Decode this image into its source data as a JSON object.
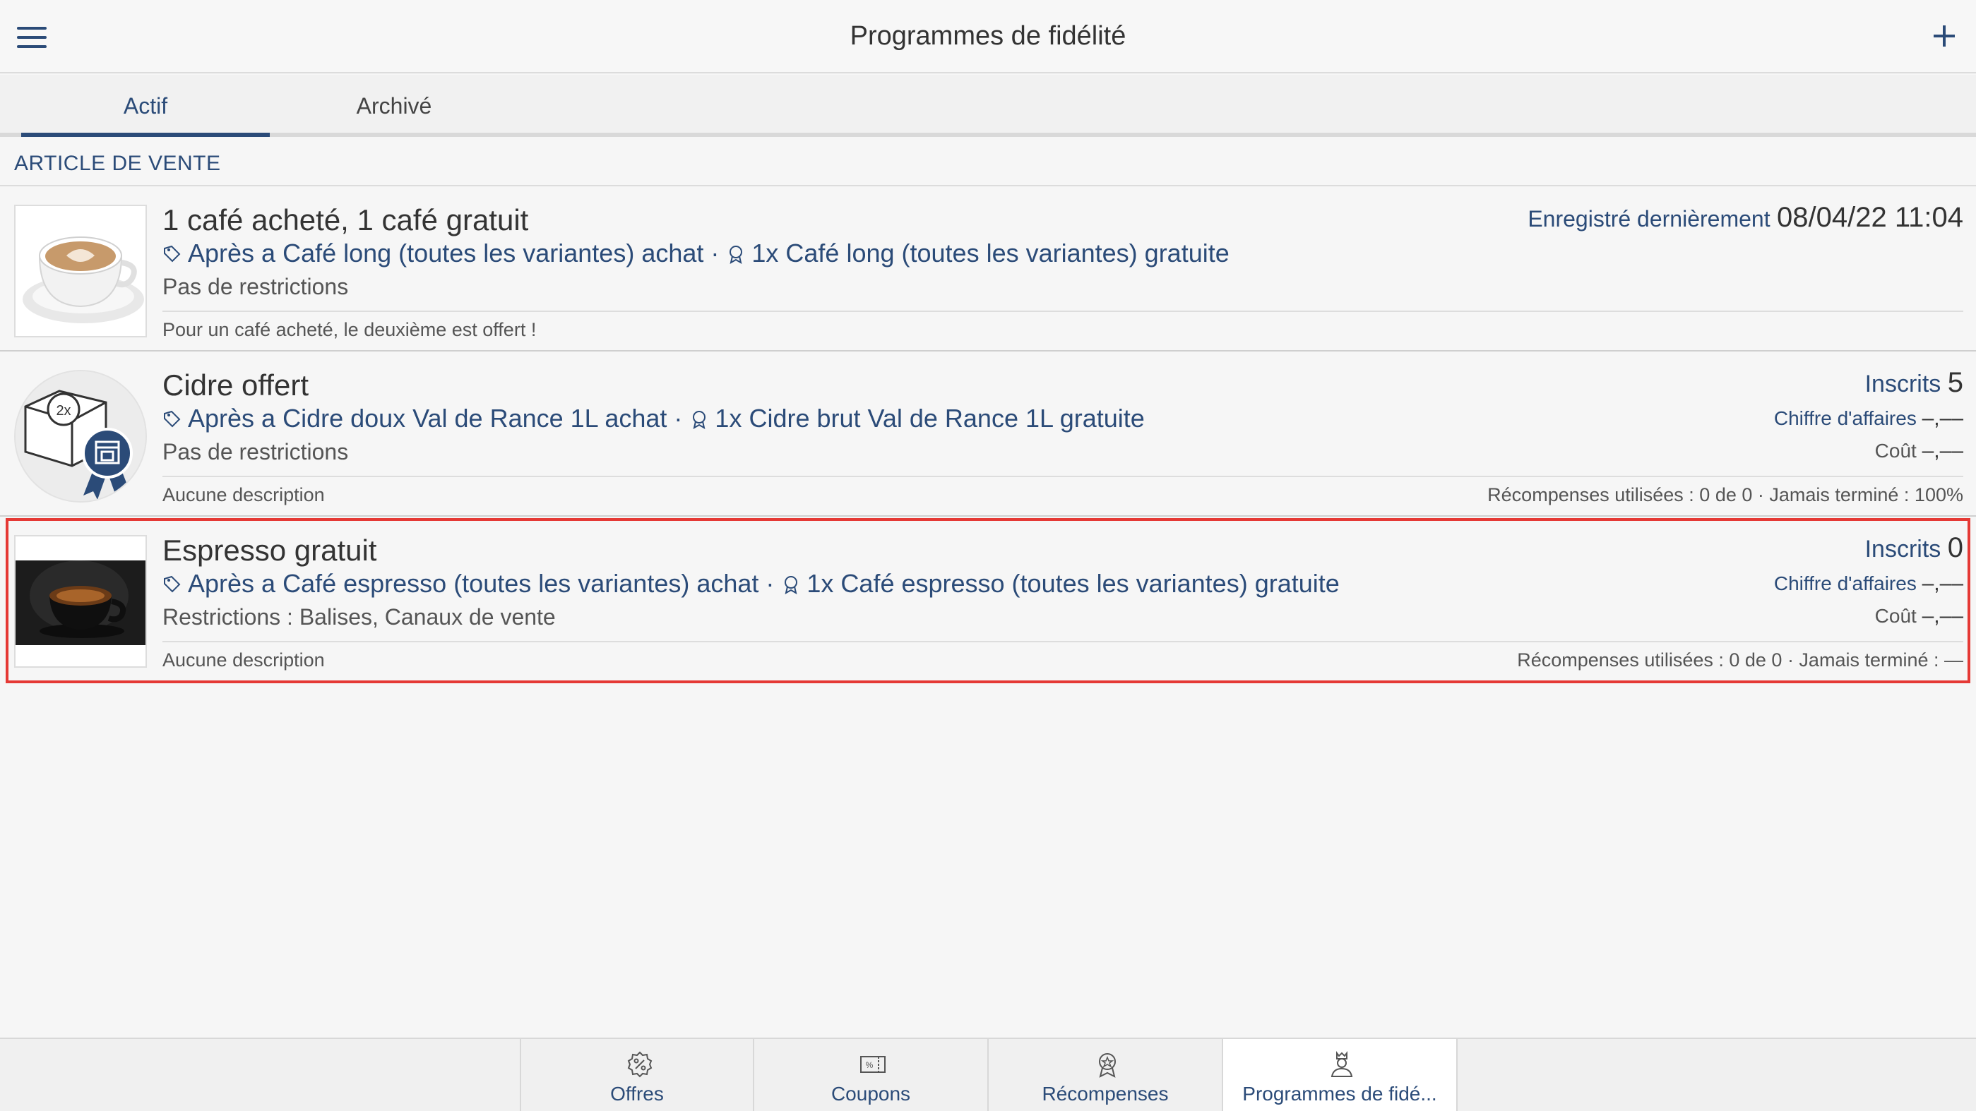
{
  "header": {
    "title": "Programmes de fidélité"
  },
  "tabs": [
    {
      "label": "Actif",
      "active": true
    },
    {
      "label": "Archivé",
      "active": false
    }
  ],
  "section": {
    "title": "ARTICLE DE VENTE"
  },
  "programs": [
    {
      "name": "1 café acheté, 1 café gratuit",
      "rule_trigger": "Après a Café long (toutes les variantes) achat",
      "rule_sep": " · ",
      "rule_reward": "1x Café long (toutes les variantes) gratuite",
      "restrictions": "Pas de restrictions",
      "description": "Pour un café acheté, le deuxième est offert !",
      "saved_label": "Enregistré dernièrement",
      "saved_value": "08/04/22 11:04"
    },
    {
      "name": "Cidre offert",
      "rule_trigger": "Après a Cidre doux Val de Rance 1L achat",
      "rule_sep": " · ",
      "rule_reward": "1x Cidre brut Val de Rance 1L gratuite",
      "restrictions": "Pas de restrictions",
      "description": "Aucune description",
      "badge_text": "2x",
      "enrolled_label": "Inscrits",
      "enrolled_value": "5",
      "revenue_label": "Chiffre d'affaires",
      "revenue_value": "–,––",
      "cost_label": "Coût",
      "cost_value": "–,––",
      "stats": "Récompenses utilisées : 0 de 0 · Jamais terminé :  100%"
    },
    {
      "name": "Espresso gratuit",
      "rule_trigger": "Après a Café espresso (toutes les variantes) achat",
      "rule_sep": " · ",
      "rule_reward": "1x Café espresso (toutes les variantes) gratuite",
      "restrictions": "Restrictions : Balises, Canaux de vente",
      "description": "Aucune description",
      "enrolled_label": "Inscrits",
      "enrolled_value": "0",
      "revenue_label": "Chiffre d'affaires",
      "revenue_value": "–,––",
      "cost_label": "Coût",
      "cost_value": "–,––",
      "stats": "Récompenses utilisées : 0 de 0 · Jamais terminé : —"
    }
  ],
  "bottom_nav": [
    {
      "label": "Offres",
      "icon": "percent-badge-icon"
    },
    {
      "label": "Coupons",
      "icon": "coupon-icon"
    },
    {
      "label": "Récompenses",
      "icon": "award-icon"
    },
    {
      "label": "Programmes de fidé...",
      "icon": "loyalty-icon",
      "active": true
    }
  ],
  "colors": {
    "accent": "#2b4b78",
    "highlight": "#e53935"
  }
}
